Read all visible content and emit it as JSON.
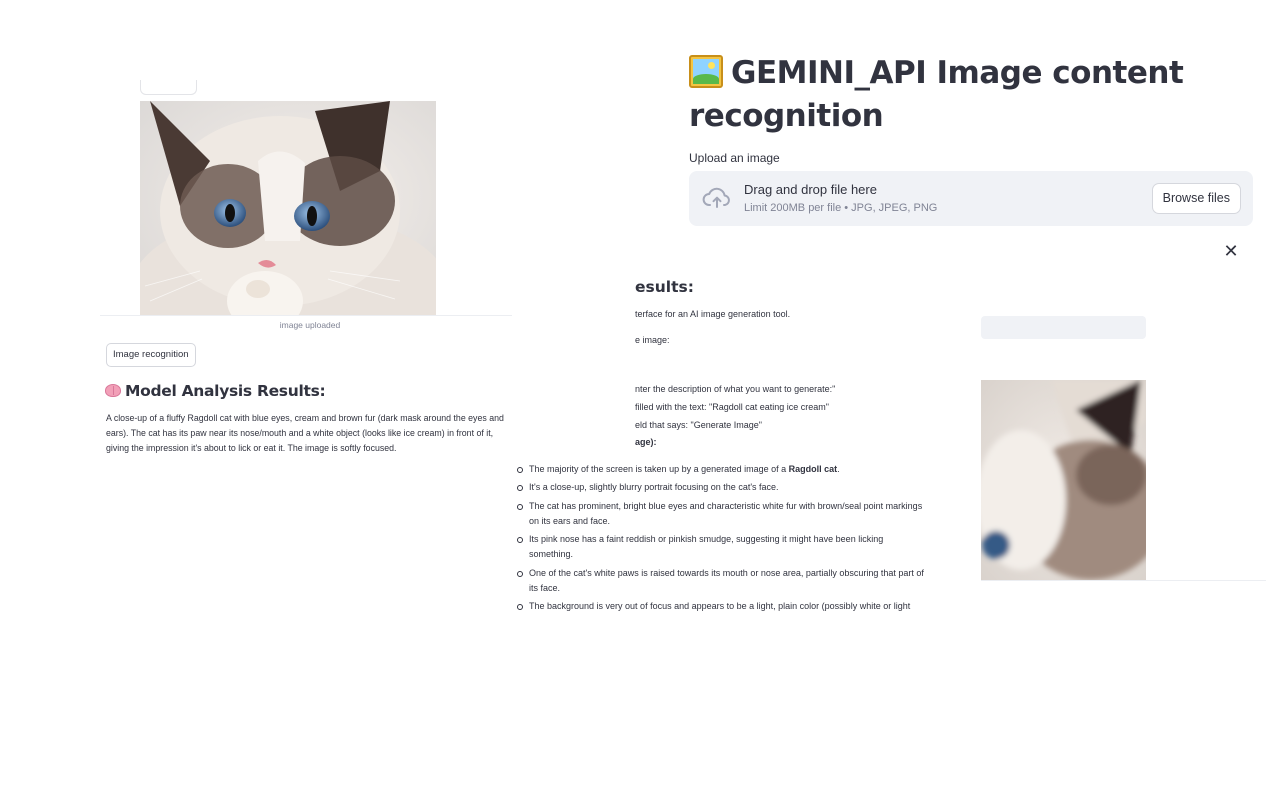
{
  "app": {
    "title": "GEMINI_API Image content recognition",
    "title_icon": "framed-picture-icon"
  },
  "uploader": {
    "label": "Upload an image",
    "drop_text": "Drag and drop file here",
    "limit_text": "Limit 200MB per file • JPG, JPEG, PNG",
    "browse_label": "Browse files"
  },
  "close_label": "✕",
  "left": {
    "caption": "image uploaded",
    "button_label": "Image recognition",
    "heading": "Model Analysis Results:",
    "result": "A close-up of a fluffy Ragdoll cat with blue eyes, cream and brown fur (dark mask around the eyes and ears). The cat has its paw near its nose/mouth and a white object (looks like ice cream) in front of it, giving the impression it's about to lick or eat it. The image is softly focused."
  },
  "middle": {
    "heading": "esults:",
    "lines": [
      "terface for an AI image generation tool.",
      "e image:",
      "nter the description of what you want to generate:\"",
      "filled with the text: \"Ragdoll cat eating ice cream\"",
      "eld that says: \"Generate Image\"",
      "age):"
    ],
    "bullets": [
      {
        "text": "The majority of the screen is taken up by a generated image of a ",
        "bold": "Ragdoll cat",
        "tail": "."
      },
      {
        "text": "It's a close-up, slightly blurry portrait focusing on the cat's face.",
        "bold": "",
        "tail": ""
      },
      {
        "text": "The cat has prominent, bright blue eyes and characteristic white fur with brown/seal point markings on its ears and face.",
        "bold": "",
        "tail": ""
      },
      {
        "text": "Its pink nose has a faint reddish or pinkish smudge, suggesting it might have been licking something.",
        "bold": "",
        "tail": ""
      },
      {
        "text": "One of the cat's white paws is raised towards its mouth or nose area, partially obscuring that part of its face.",
        "bold": "",
        "tail": ""
      },
      {
        "text": "The background is very out of focus and appears to be a light, plain color (possibly white or light",
        "bold": "",
        "tail": ""
      }
    ]
  },
  "colors": {
    "text": "#31333f",
    "muted": "#808495",
    "dropzone_bg": "#f0f2f6"
  }
}
